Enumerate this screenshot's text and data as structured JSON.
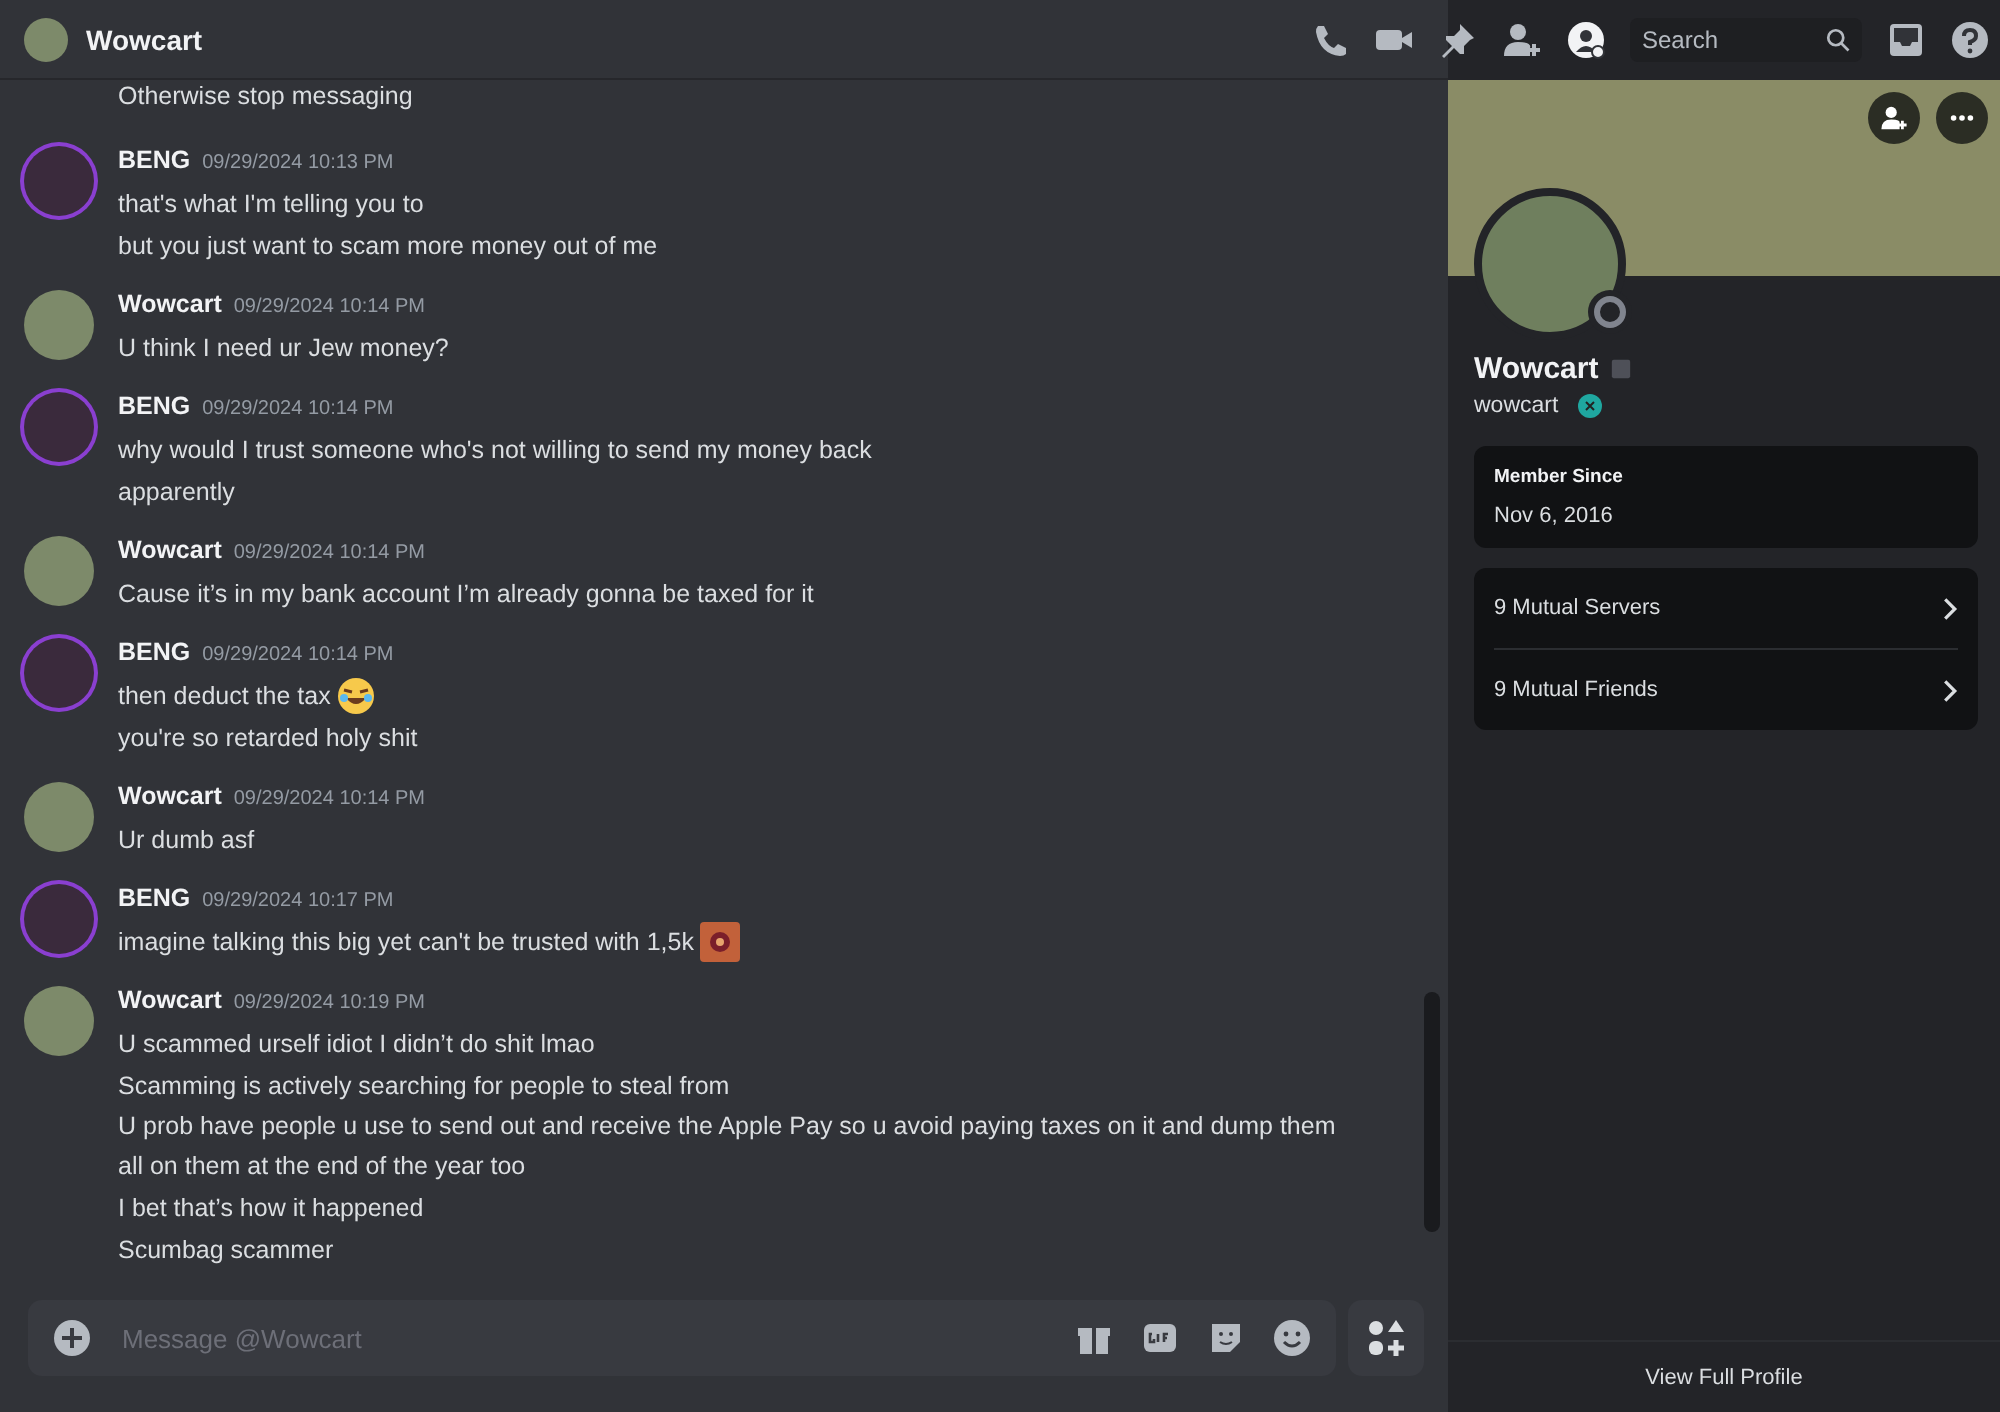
{
  "header": {
    "title": "Wowcart",
    "search": {
      "placeholder": "Search"
    }
  },
  "messages": {
    "partial_line": "Otherwise stop messaging",
    "groups": [
      {
        "author": "BENG",
        "kind": "ringed",
        "timestamp": "09/29/2024 10:13 PM",
        "lines": [
          {
            "kind": "plain",
            "text": "that's what I'm telling you to"
          },
          {
            "kind": "plain",
            "text": "but you just want to scam more money out of me"
          }
        ]
      },
      {
        "author": "Wowcart",
        "kind": "plain",
        "timestamp": "09/29/2024 10:14 PM",
        "lines": [
          {
            "kind": "plain",
            "text": "U think I need ur Jew money?"
          }
        ]
      },
      {
        "author": "BENG",
        "kind": "ringed",
        "timestamp": "09/29/2024 10:14 PM",
        "lines": [
          {
            "kind": "plain",
            "text": "why would I trust someone who's not willing to send my money back"
          },
          {
            "kind": "plain",
            "text": "apparently"
          }
        ]
      },
      {
        "author": "Wowcart",
        "kind": "plain",
        "timestamp": "09/29/2024 10:14 PM",
        "lines": [
          {
            "kind": "plain",
            "text": "Cause it’s in my bank account I’m already gonna be taxed for it"
          }
        ]
      },
      {
        "author": "BENG",
        "kind": "ringed",
        "timestamp": "09/29/2024 10:14 PM",
        "lines": [
          {
            "kind": "laughing",
            "text": "then deduct the tax"
          },
          {
            "kind": "plain",
            "text": "you're so retarded holy shit"
          }
        ]
      },
      {
        "author": "Wowcart",
        "kind": "plain",
        "timestamp": "09/29/2024 10:14 PM",
        "lines": [
          {
            "kind": "plain",
            "text": "Ur dumb asf"
          }
        ]
      },
      {
        "author": "BENG",
        "kind": "ringed",
        "timestamp": "09/29/2024 10:17 PM",
        "lines": [
          {
            "kind": "sticker",
            "text": "imagine talking this big yet can't be trusted with 1,5k"
          }
        ]
      },
      {
        "author": "Wowcart",
        "kind": "plain",
        "timestamp": "09/29/2024 10:19 PM",
        "lines": [
          {
            "kind": "plain",
            "text": "U scammed urself idiot I didn’t do shit lmao"
          },
          {
            "kind": "plain",
            "text": "Scamming is actively searching for people to steal from"
          },
          {
            "kind": "plain",
            "text": "U prob have people u use to send out and receive the Apple Pay so u avoid paying taxes on it and dump them all on them at the end of the year too"
          },
          {
            "kind": "plain",
            "text": "I bet that’s how it happened"
          },
          {
            "kind": "plain",
            "text": "Scumbag scammer"
          }
        ]
      }
    ]
  },
  "composer": {
    "placeholder": "Message @Wowcart"
  },
  "profile": {
    "display_name": "Wowcart",
    "username": "wowcart",
    "online": false,
    "member_since_label": "Member Since",
    "member_since": "Nov 6, 2016",
    "links": [
      {
        "label": "9 Mutual Servers"
      },
      {
        "label": "9 Mutual Friends"
      }
    ],
    "view_full_profile": "View Full Profile"
  }
}
